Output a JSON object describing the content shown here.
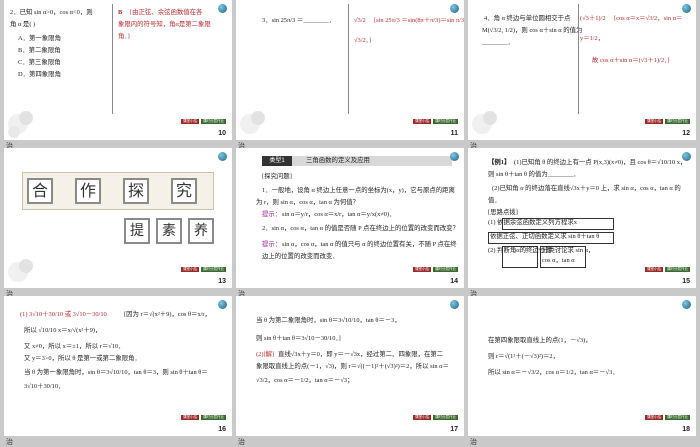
{
  "slides": [
    {
      "num": "10",
      "under": "",
      "q": "2．已知 sin α>0，cos α<0，则",
      "q2": "角 α 是(    )",
      "opts": [
        "A．第一象限角",
        "B．第二象限角",
        "C．第三象限角",
        "D．第四象限角"
      ],
      "ans": "B",
      "exp1": "[由正弦、余弦函数值在各",
      "exp2": "象限内的符号知，角α是第二象限",
      "exp3": "角．]"
    },
    {
      "num": "11",
      "under": "",
      "q": "3．sin 25π/3 ＝________．",
      "ans": "√3/2",
      "exp1": "[sin 25π/3 ＝sin(8π＋π/3)＝sin π/3 ＝",
      "exp2": "√3/2．]"
    },
    {
      "num": "12",
      "under": "",
      "q": "4．角 α 终边与单位圆相交于点",
      "q2": "M(√3/2, 1/2)，则 cos α＋sin α 的值为",
      "q3": "________．",
      "ans": "(√3＋1)/2",
      "exp1": "[cos α＝x＝√3/2，sin α＝",
      "exp2": "y＝1/2，",
      "exp3": "故 cos α＋sin α＝(√3＋1)/2．]"
    },
    {
      "num": "13",
      "under": "",
      "banner": [
        "合",
        "作",
        "探",
        "究"
      ],
      "sub": [
        "提",
        "素",
        "养"
      ]
    },
    {
      "num": "14",
      "under": "",
      "tag": "类型1",
      "title": "三角函数的定义及应用",
      "head": "[探究问题]",
      "p1": "1．一般地，设角 α 终边上任意一点的坐标为(x，y)，它与原点的距离",
      "p2": "为 r，则 sin α，cos α，tan α 为何值？",
      "hint1": "提示：",
      "h1": "sin α＝y/r，cos α＝x/r，tan α＝y/x(x≠0)．",
      "p3": "2．sin α，cos α，tan α 的值是否随 P 点在终边上的位置的改变而改变？",
      "hint2": "提示：",
      "h2": "sin α，cos α，tan α 的值只与 α 的终边位置有关，不随 P 点在终",
      "h3": "边上的位置的改变而改变．"
    },
    {
      "num": "15",
      "under": "",
      "ex": "【例1】",
      "e1": "(1)已知角 θ 的终边上有一点 P(x,3)(x≠0)，且 cos θ＝√10/10 x，",
      "e2": "则 sin θ＋tan θ 的值为________．",
      "e3": "(2)已知角 α 的终边落在直线√3x＋y＝0 上，求 sin α，cos α，tan α 的",
      "e4": "值．",
      "think": "[思路点拨]",
      "t1": "(1) 依据余弦函数定义列方程求x",
      "t2": "依据正弦、正切函数定义求 sin θ＋tan θ",
      "t3": "(2) 判断角α的终边位置",
      "t4": "分类讨论求 sin α，",
      "t5": "cos α，tan α"
    },
    {
      "num": "16",
      "under": "",
      "l1": "(1) 3√10＋30/10 或 3√10－30/10",
      "l1b": "[因为 r＝√(x²＋9)，cos θ＝x/r，",
      "l2": "所以 √10/10 x＝x/√(x²＋9)，",
      "l3": "又 x≠0，所以 x＝±1，所以 r＝√10．",
      "l4": "又 y＝3>0，所以 θ 是第一或第二象限角．",
      "l5": "当 θ 为第一象限角时，sin θ＝3√10/10，tan θ＝3，则 sin θ＋tan θ＝",
      "l6": "3√10＋30/10．"
    },
    {
      "num": "17",
      "under": "",
      "l1": "当 θ 为第二象限角时，sin θ＝3√10/10，tan θ＝－3，",
      "l2": "则 sin θ＋tan θ＝3√10－30/10．]",
      "l3": "(2)[解]",
      "l3b": "直线√3x＋y＝0，即 y＝－√3x，经过第二、四象限，在第二",
      "l4": "象限取直线上的点(－1，√3)，则 r＝√((－1)²＋(√3)²)＝2，所以 sin α＝",
      "l5": "√3/2，cos α＝－1/2，tan α＝－√3；"
    },
    {
      "num": "18",
      "under": "",
      "l1": "在第四象限取直线上的点(1，－√3)，",
      "l2": "则 r＝√(1²＋(－√3)²)＝2，",
      "l3": "所以 sin α＝－√3/2，cos α＝1/2，tan α＝－√3．"
    }
  ],
  "labels": [
    "治",
    "治",
    "治",
    "治",
    "治",
    "治",
    "治",
    "治",
    "治"
  ],
  "badges": [
    "课堂小结",
    "课时分层作业"
  ]
}
